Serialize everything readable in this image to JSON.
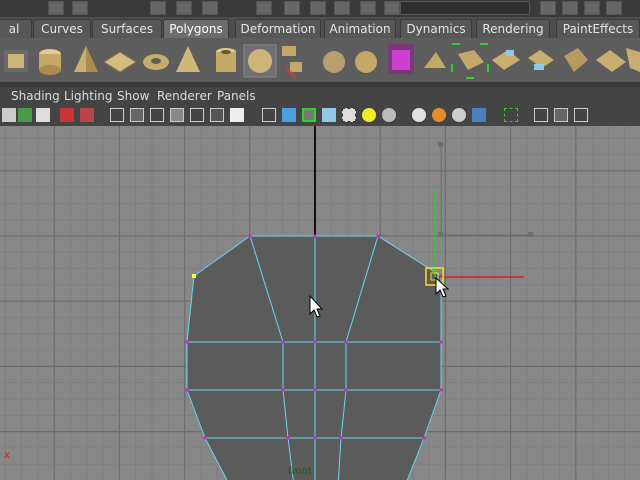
{
  "shelf_tabs": [
    {
      "label": "al"
    },
    {
      "label": "Curves"
    },
    {
      "label": "Surfaces"
    },
    {
      "label": "Polygons"
    },
    {
      "label": "Deformation"
    },
    {
      "label": "Animation"
    },
    {
      "label": "Dynamics"
    },
    {
      "label": "Rendering"
    },
    {
      "label": "PaintEffects"
    }
  ],
  "active_tab": "Polygons",
  "panel_menu": [
    {
      "label": "Shading"
    },
    {
      "label": "Lighting"
    },
    {
      "label": "Show"
    },
    {
      "label": "Renderer"
    },
    {
      "label": "Panels"
    }
  ],
  "viewport": {
    "camera_label": "front",
    "axis_x_label": "x"
  },
  "colors": {
    "grid_bg": "#878787",
    "mesh_fill": "#5b5b5b",
    "edge": "#66d9ee",
    "vertex": "#d51ed1",
    "selected_vertex": "#ffff44",
    "manip_x": "#d22020",
    "manip_y": "#2dcc2d"
  }
}
